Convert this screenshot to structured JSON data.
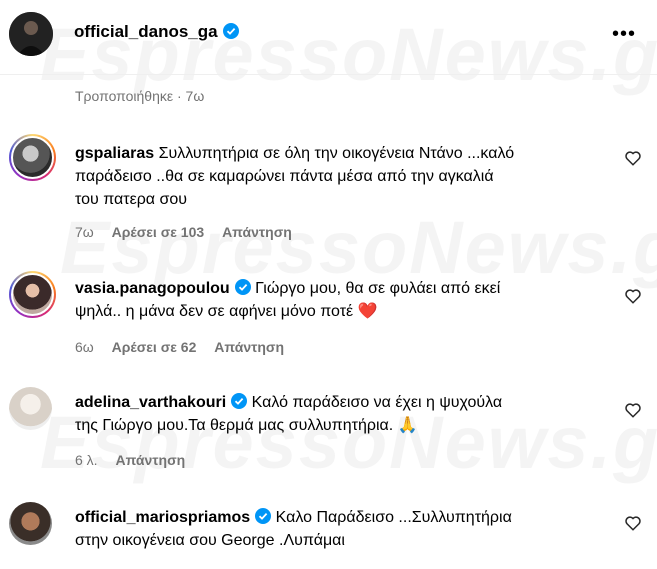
{
  "header": {
    "username": "official_danos_ga",
    "more_label": "•••",
    "edited": "Τροποποιήθηκε · 7ω"
  },
  "watermark": "EspressoNews.gr",
  "comments": [
    {
      "username": "gspaliaras",
      "verified": false,
      "line1": "Συλλυπητήρια σε όλη την οικογένεια Ντάνο ...καλό",
      "line2": "παράδεισο ..θα σε καμαρώνει πάντα μέσα από την αγκαλιά",
      "line3": "του πατερα σου",
      "time": "7ω",
      "likes": "Αρέσει σε 103",
      "reply": "Απάντηση"
    },
    {
      "username": "vasia.panagopoulou",
      "verified": true,
      "line1": "Γιώργο μου, θα σε φυλάει από εκεί",
      "line2": "ψηλά.. η μάνα δεν σε αφήνει μόνο ποτέ",
      "emoji": "❤️",
      "time": "6ω",
      "likes": "Αρέσει σε 62",
      "reply": "Απάντηση"
    },
    {
      "username": "adelina_varthakouri",
      "verified": true,
      "line1": "Καλό παράδεισο να έχει η ψυχούλα",
      "line2": "της Γιώργο μου.Τα θερμά μας συλλυπητήρια.",
      "emoji": "🙏",
      "time": "6 λ.",
      "reply": "Απάντηση"
    },
    {
      "username": "official_mariospriamos",
      "verified": true,
      "line1": "Καλο Παράδεισο ...Συλλυπητήρια",
      "line2": "στην οικογένεια σου George .Λυπάμαι"
    }
  ],
  "colors": {
    "verified": "#0095f6",
    "meta": "#737373",
    "heart_emoji": "#e0245e"
  }
}
